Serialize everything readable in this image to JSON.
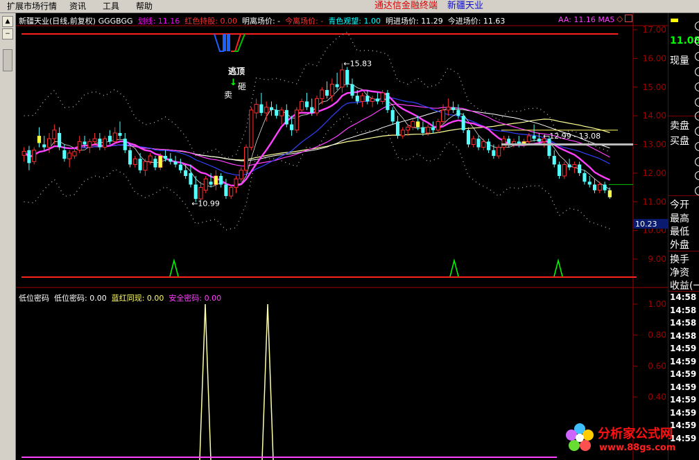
{
  "menu": [
    "扩展市场行情",
    "资讯",
    "工具",
    "帮助"
  ],
  "window_title": "通达信金融终端",
  "stock_name": "新疆天业",
  "main_header": [
    {
      "text": "新疆天业(日线,前复权) GGGBGG",
      "color": "#ffffff"
    },
    {
      "text": "划线: 11.16",
      "color": "#ff00ff"
    },
    {
      "text": "红色持股: 0.00",
      "color": "#ff3030"
    },
    {
      "text": "明离场价: -",
      "color": "#ffffff"
    },
    {
      "text": "今离场价: -",
      "color": "#ff3030"
    },
    {
      "text": "青色观望: 1.00",
      "color": "#00ffff"
    },
    {
      "text": "明进场价: 11.29",
      "color": "#ffffff"
    },
    {
      "text": "今进场价: 11.63",
      "color": "#ffffff"
    }
  ],
  "ma_label": "AA: 11.16  MA5",
  "sub_header": [
    {
      "text": "低位密码",
      "color": "#ffffff"
    },
    {
      "text": "低位密码: 0.00",
      "color": "#ffffff"
    },
    {
      "text": "蓝红同现: 0.00",
      "color": "#ffff66"
    },
    {
      "text": "安全密码: 0.00",
      "color": "#ff40ff"
    }
  ],
  "price_axis": [
    "17.00",
    "16.00",
    "15.00",
    "14.00",
    "13.00",
    "12.00",
    "11.00",
    "10.00",
    "9.00"
  ],
  "current_price_tag": "10.23",
  "sub_axis": [
    "1.00",
    "0.80",
    "0.60",
    "0.40"
  ],
  "annotations": {
    "high_label": "15.83",
    "low_label": "10.99",
    "range_label": "12.99 - 13.08",
    "sell_text": "卖",
    "smash_text": "砸",
    "top_text": "逃顶"
  },
  "right_panel": {
    "price": "11.08",
    "labels": [
      "现量",
      "卖盘",
      "买盘",
      "今开",
      "最高",
      "最低",
      "外盘",
      "换手",
      "净资",
      "收益(一"
    ],
    "times": [
      "14:58",
      "14:58",
      "14:58",
      "14:58",
      "14:59",
      "14:59",
      "14:59",
      "14:59",
      "14:59",
      "14:59",
      "14:59",
      "14:59"
    ]
  },
  "watermark": {
    "text": "分析家公式网",
    "url": "www.88gs.com"
  },
  "chart_data": {
    "type": "candlestick",
    "title": "新疆天业(日线,前复权)",
    "ylim": [
      8.7,
      17.2
    ],
    "candles": [
      {
        "o": 12.62,
        "h": 12.9,
        "l": 12.4,
        "c": 12.76
      },
      {
        "o": 12.8,
        "h": 12.95,
        "l": 12.1,
        "c": 12.35
      },
      {
        "o": 12.4,
        "h": 12.9,
        "l": 12.3,
        "c": 12.8
      },
      {
        "o": 13.3,
        "h": 13.6,
        "l": 12.9,
        "c": 13.05
      },
      {
        "o": 13.0,
        "h": 13.3,
        "l": 12.8,
        "c": 12.9
      },
      {
        "o": 12.9,
        "h": 13.4,
        "l": 12.7,
        "c": 13.2
      },
      {
        "o": 13.2,
        "h": 13.7,
        "l": 13.0,
        "c": 13.5
      },
      {
        "o": 13.4,
        "h": 13.6,
        "l": 12.8,
        "c": 12.9
      },
      {
        "o": 12.8,
        "h": 13.0,
        "l": 12.4,
        "c": 12.5
      },
      {
        "o": 12.5,
        "h": 12.8,
        "l": 12.2,
        "c": 12.7
      },
      {
        "o": 12.6,
        "h": 12.9,
        "l": 12.5,
        "c": 12.75
      },
      {
        "o": 12.8,
        "h": 13.3,
        "l": 12.7,
        "c": 13.1
      },
      {
        "o": 13.1,
        "h": 13.3,
        "l": 12.9,
        "c": 13.0
      },
      {
        "o": 12.9,
        "h": 13.2,
        "l": 12.7,
        "c": 13.1
      },
      {
        "o": 13.1,
        "h": 13.4,
        "l": 13.0,
        "c": 13.2
      },
      {
        "o": 13.2,
        "h": 13.4,
        "l": 12.8,
        "c": 12.9
      },
      {
        "o": 12.9,
        "h": 13.3,
        "l": 12.8,
        "c": 13.2
      },
      {
        "o": 13.3,
        "h": 13.5,
        "l": 13.0,
        "c": 13.1
      },
      {
        "o": 13.1,
        "h": 13.6,
        "l": 13.0,
        "c": 13.4
      },
      {
        "o": 13.4,
        "h": 13.8,
        "l": 13.2,
        "c": 13.3
      },
      {
        "o": 13.2,
        "h": 13.4,
        "l": 12.7,
        "c": 12.8
      },
      {
        "o": 12.8,
        "h": 12.9,
        "l": 12.2,
        "c": 12.3
      },
      {
        "o": 12.3,
        "h": 12.6,
        "l": 12.2,
        "c": 12.5
      },
      {
        "o": 12.5,
        "h": 12.7,
        "l": 12.0,
        "c": 12.1
      },
      {
        "o": 12.1,
        "h": 12.5,
        "l": 11.9,
        "c": 12.4
      },
      {
        "o": 12.4,
        "h": 12.7,
        "l": 12.3,
        "c": 12.6
      },
      {
        "o": 12.5,
        "h": 12.6,
        "l": 12.1,
        "c": 12.2
      },
      {
        "o": 12.2,
        "h": 12.7,
        "l": 12.1,
        "c": 12.6
      },
      {
        "o": 12.6,
        "h": 12.8,
        "l": 12.4,
        "c": 12.5
      },
      {
        "o": 12.5,
        "h": 12.7,
        "l": 12.3,
        "c": 12.4
      },
      {
        "o": 12.4,
        "h": 12.6,
        "l": 12.2,
        "c": 12.3
      },
      {
        "o": 12.3,
        "h": 12.5,
        "l": 12.0,
        "c": 12.1
      },
      {
        "o": 12.1,
        "h": 12.3,
        "l": 11.8,
        "c": 11.9
      },
      {
        "o": 12.0,
        "h": 12.3,
        "l": 11.5,
        "c": 11.6
      },
      {
        "o": 11.6,
        "h": 11.9,
        "l": 10.99,
        "c": 11.1
      },
      {
        "o": 11.1,
        "h": 11.7,
        "l": 11.0,
        "c": 11.5
      },
      {
        "o": 11.4,
        "h": 11.9,
        "l": 11.3,
        "c": 11.8
      },
      {
        "o": 11.7,
        "h": 12.0,
        "l": 11.5,
        "c": 11.6
      },
      {
        "o": 11.6,
        "h": 12.1,
        "l": 11.4,
        "c": 11.9
      },
      {
        "o": 11.9,
        "h": 12.0,
        "l": 11.5,
        "c": 11.6
      },
      {
        "o": 11.6,
        "h": 11.8,
        "l": 11.1,
        "c": 11.2
      },
      {
        "o": 11.2,
        "h": 11.6,
        "l": 11.1,
        "c": 11.5
      },
      {
        "o": 11.5,
        "h": 11.9,
        "l": 11.3,
        "c": 11.8
      },
      {
        "o": 11.8,
        "h": 12.2,
        "l": 11.7,
        "c": 12.1
      },
      {
        "o": 12.1,
        "h": 13.0,
        "l": 12.0,
        "c": 12.9
      },
      {
        "o": 12.9,
        "h": 14.3,
        "l": 12.8,
        "c": 14.2
      },
      {
        "o": 14.1,
        "h": 14.6,
        "l": 13.9,
        "c": 14.4
      },
      {
        "o": 14.4,
        "h": 14.8,
        "l": 14.0,
        "c": 14.1
      },
      {
        "o": 14.1,
        "h": 14.5,
        "l": 13.8,
        "c": 14.3
      },
      {
        "o": 14.3,
        "h": 14.5,
        "l": 14.0,
        "c": 14.2
      },
      {
        "o": 14.2,
        "h": 14.4,
        "l": 13.9,
        "c": 14.0
      },
      {
        "o": 14.0,
        "h": 14.3,
        "l": 13.7,
        "c": 14.2
      },
      {
        "o": 14.2,
        "h": 14.4,
        "l": 13.6,
        "c": 13.7
      },
      {
        "o": 13.7,
        "h": 14.0,
        "l": 13.3,
        "c": 13.5
      },
      {
        "o": 13.5,
        "h": 14.3,
        "l": 13.4,
        "c": 14.2
      },
      {
        "o": 14.2,
        "h": 14.6,
        "l": 14.1,
        "c": 14.5
      },
      {
        "o": 14.5,
        "h": 14.8,
        "l": 14.2,
        "c": 14.3
      },
      {
        "o": 14.3,
        "h": 14.6,
        "l": 14.0,
        "c": 14.1
      },
      {
        "o": 14.1,
        "h": 14.7,
        "l": 14.0,
        "c": 14.6
      },
      {
        "o": 14.6,
        "h": 15.0,
        "l": 14.4,
        "c": 14.9
      },
      {
        "o": 14.9,
        "h": 15.2,
        "l": 14.6,
        "c": 14.7
      },
      {
        "o": 14.7,
        "h": 15.3,
        "l": 14.5,
        "c": 15.1
      },
      {
        "o": 15.1,
        "h": 15.5,
        "l": 14.9,
        "c": 15.0
      },
      {
        "o": 15.0,
        "h": 15.83,
        "l": 14.8,
        "c": 15.6
      },
      {
        "o": 15.6,
        "h": 15.7,
        "l": 15.0,
        "c": 15.1
      },
      {
        "o": 15.1,
        "h": 15.3,
        "l": 14.6,
        "c": 14.7
      },
      {
        "o": 14.7,
        "h": 14.9,
        "l": 14.4,
        "c": 14.5
      },
      {
        "o": 14.5,
        "h": 14.8,
        "l": 14.3,
        "c": 14.7
      },
      {
        "o": 14.7,
        "h": 14.9,
        "l": 14.4,
        "c": 14.5
      },
      {
        "o": 14.5,
        "h": 14.7,
        "l": 14.3,
        "c": 14.6
      },
      {
        "o": 14.6,
        "h": 14.8,
        "l": 14.4,
        "c": 14.5
      },
      {
        "o": 14.5,
        "h": 14.9,
        "l": 14.4,
        "c": 14.8
      },
      {
        "o": 14.8,
        "h": 14.9,
        "l": 14.1,
        "c": 14.2
      },
      {
        "o": 14.2,
        "h": 14.3,
        "l": 13.7,
        "c": 13.8
      },
      {
        "o": 13.8,
        "h": 14.0,
        "l": 13.2,
        "c": 13.3
      },
      {
        "o": 13.3,
        "h": 13.6,
        "l": 13.2,
        "c": 13.5
      },
      {
        "o": 13.5,
        "h": 13.7,
        "l": 13.3,
        "c": 13.6
      },
      {
        "o": 13.6,
        "h": 13.9,
        "l": 13.5,
        "c": 13.8
      },
      {
        "o": 13.8,
        "h": 14.0,
        "l": 13.5,
        "c": 13.6
      },
      {
        "o": 13.6,
        "h": 13.8,
        "l": 13.3,
        "c": 13.4
      },
      {
        "o": 13.4,
        "h": 13.7,
        "l": 13.3,
        "c": 13.6
      },
      {
        "o": 13.6,
        "h": 13.8,
        "l": 13.4,
        "c": 13.5
      },
      {
        "o": 13.5,
        "h": 13.9,
        "l": 13.4,
        "c": 13.8
      },
      {
        "o": 13.8,
        "h": 14.4,
        "l": 13.7,
        "c": 14.2
      },
      {
        "o": 14.2,
        "h": 14.6,
        "l": 14.0,
        "c": 14.3
      },
      {
        "o": 14.3,
        "h": 14.5,
        "l": 14.1,
        "c": 14.2
      },
      {
        "o": 14.2,
        "h": 14.4,
        "l": 13.9,
        "c": 14.0
      },
      {
        "o": 14.0,
        "h": 14.1,
        "l": 13.4,
        "c": 13.5
      },
      {
        "o": 13.5,
        "h": 13.6,
        "l": 12.9,
        "c": 13.0
      },
      {
        "o": 13.0,
        "h": 13.3,
        "l": 12.9,
        "c": 13.2
      },
      {
        "o": 13.2,
        "h": 13.3,
        "l": 12.8,
        "c": 12.9
      },
      {
        "o": 12.9,
        "h": 13.2,
        "l": 12.8,
        "c": 13.1
      },
      {
        "o": 13.1,
        "h": 13.2,
        "l": 12.7,
        "c": 12.8
      },
      {
        "o": 12.8,
        "h": 13.0,
        "l": 12.5,
        "c": 12.6
      },
      {
        "o": 12.6,
        "h": 13.0,
        "l": 12.5,
        "c": 12.9
      },
      {
        "o": 12.9,
        "h": 13.3,
        "l": 12.8,
        "c": 13.2
      },
      {
        "o": 13.2,
        "h": 13.3,
        "l": 12.9,
        "c": 13.0
      },
      {
        "o": 13.0,
        "h": 13.2,
        "l": 12.9,
        "c": 13.1
      },
      {
        "o": 13.1,
        "h": 13.3,
        "l": 12.9,
        "c": 13.0
      },
      {
        "o": 13.0,
        "h": 13.2,
        "l": 12.9,
        "c": 13.1
      },
      {
        "o": 13.1,
        "h": 13.4,
        "l": 13.0,
        "c": 13.3
      },
      {
        "o": 13.3,
        "h": 13.7,
        "l": 13.1,
        "c": 13.2
      },
      {
        "o": 13.2,
        "h": 13.4,
        "l": 13.0,
        "c": 13.1
      },
      {
        "o": 13.1,
        "h": 13.3,
        "l": 12.9,
        "c": 13.2
      },
      {
        "o": 13.2,
        "h": 13.3,
        "l": 12.5,
        "c": 12.6
      },
      {
        "o": 12.6,
        "h": 12.8,
        "l": 12.2,
        "c": 12.3
      },
      {
        "o": 12.3,
        "h": 12.4,
        "l": 11.8,
        "c": 11.9
      },
      {
        "o": 11.9,
        "h": 12.4,
        "l": 11.8,
        "c": 12.3
      },
      {
        "o": 12.3,
        "h": 12.5,
        "l": 12.1,
        "c": 12.2
      },
      {
        "o": 12.2,
        "h": 12.4,
        "l": 12.0,
        "c": 12.3
      },
      {
        "o": 12.3,
        "h": 12.4,
        "l": 11.9,
        "c": 12.0
      },
      {
        "o": 12.0,
        "h": 12.1,
        "l": 11.6,
        "c": 11.7
      },
      {
        "o": 11.7,
        "h": 11.9,
        "l": 11.5,
        "c": 11.6
      },
      {
        "o": 11.6,
        "h": 11.8,
        "l": 11.3,
        "c": 11.4
      },
      {
        "o": 11.4,
        "h": 11.7,
        "l": 11.3,
        "c": 11.6
      },
      {
        "o": 11.6,
        "h": 11.7,
        "l": 11.3,
        "c": 11.4
      },
      {
        "o": 11.4,
        "h": 11.5,
        "l": 11.1,
        "c": 11.16
      }
    ]
  }
}
